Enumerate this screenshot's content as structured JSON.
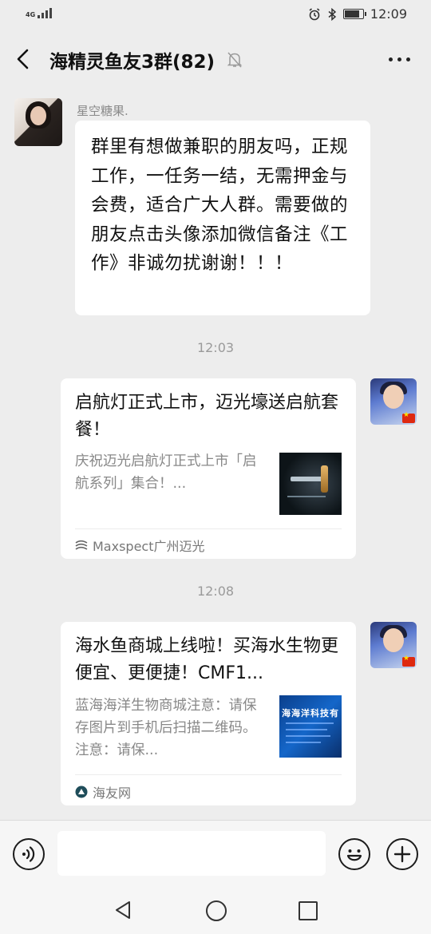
{
  "status_bar": {
    "network": "4G",
    "time": "12:09",
    "icons": [
      "alarm-icon",
      "bluetooth-icon",
      "battery-icon"
    ]
  },
  "header": {
    "title": "海精灵鱼友3群(82)",
    "icons": [
      "back-arrow-icon",
      "mute-bell-icon",
      "more-dots-icon"
    ]
  },
  "messages": [
    {
      "type": "text",
      "sender": "星空糖果.",
      "text": "群里有想做兼职的朋友吗，正规工作，一任务一结，无需押金与会费，适合广大人群。需要做的朋友点击头像添加微信备注《工作》非诚勿扰谢谢！！！"
    },
    {
      "type": "timestamp",
      "text": "12:03"
    },
    {
      "type": "link_card",
      "title": "启航灯正式上市，迈光壕送启航套餐！",
      "desc": "庆祝迈光启航灯正式上市「启航系列」集合！...",
      "source": "Maxspect广州迈光"
    },
    {
      "type": "timestamp",
      "text": "12:08"
    },
    {
      "type": "link_card",
      "title": "海水鱼商城上线啦！买海水生物更便宜、更便捷！CMF1...",
      "desc": "蓝海海洋生物商城注意：请保存图片到手机后扫描二维码。注意：请保...",
      "source": "海友网",
      "thumb_text": "海海洋科技有"
    }
  ],
  "input_bar": {
    "icons": [
      "voice-icon",
      "emoji-icon",
      "plus-icon"
    ]
  },
  "nav_bar": {
    "icons": [
      "nav-back-icon",
      "nav-home-icon",
      "nav-recent-icon"
    ]
  }
}
